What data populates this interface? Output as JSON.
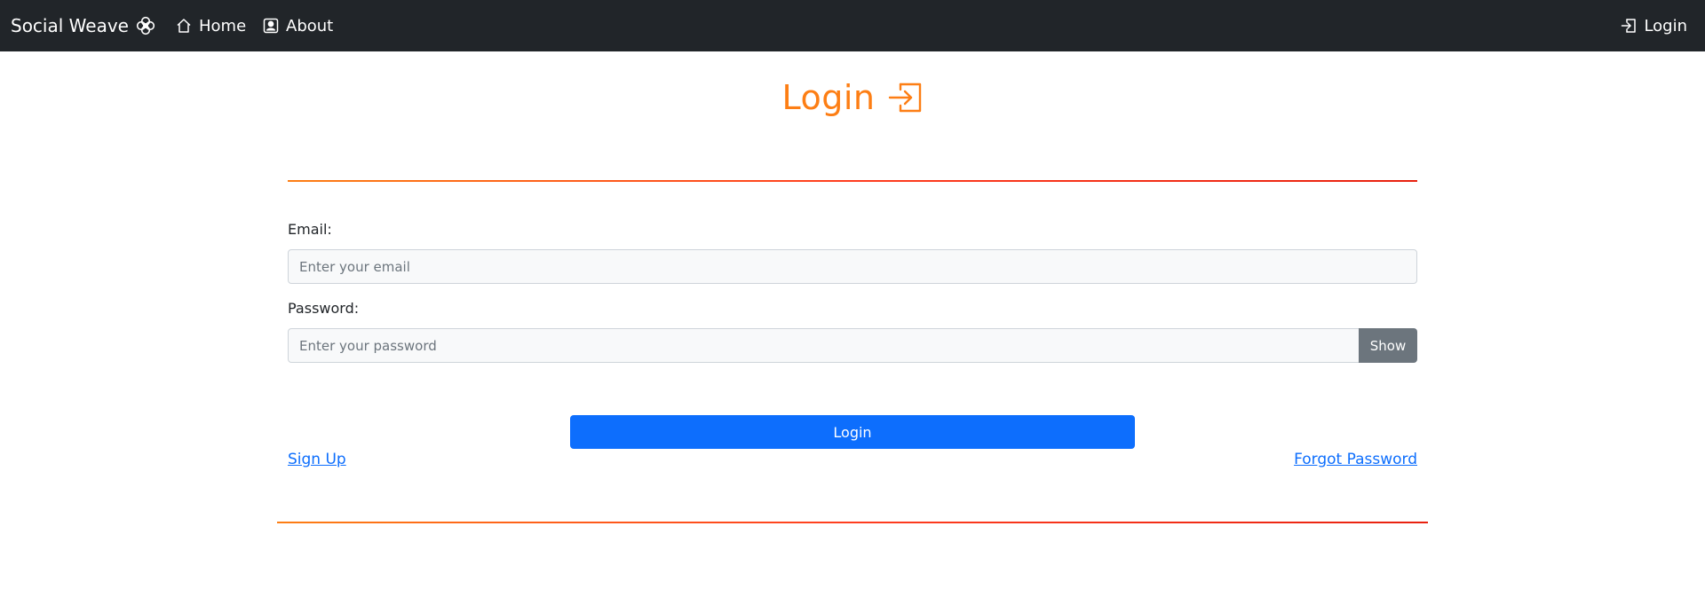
{
  "navbar": {
    "brand": "Social Weave",
    "brand_icon": "flower-icon",
    "items": [
      {
        "label": "Home",
        "icon": "house-icon"
      },
      {
        "label": "About",
        "icon": "person-badge-icon"
      }
    ],
    "login": {
      "label": "Login",
      "icon": "box-arrow-in-icon"
    }
  },
  "page": {
    "title": "Login",
    "title_icon": "box-arrow-in-icon"
  },
  "form": {
    "email_label": "Email:",
    "email_placeholder": "Enter your email",
    "email_value": "",
    "password_label": "Password:",
    "password_placeholder": "Enter your password",
    "password_value": "",
    "show_label": "Show",
    "submit_label": "Login",
    "signup_link": "Sign Up",
    "forgot_link": "Forgot Password"
  },
  "colors": {
    "navbar_bg": "#212529",
    "accent": "#fd7e14",
    "primary": "#0d6efd",
    "secondary": "#6c757d",
    "rule_gradient": [
      "#fd7e14",
      "#e8210f"
    ]
  }
}
